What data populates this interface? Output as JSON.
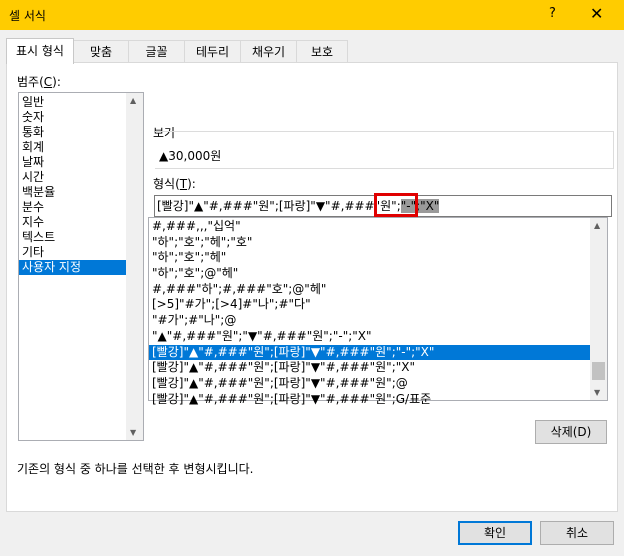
{
  "window": {
    "title": "셀 서식",
    "help_glyph": "?",
    "close_glyph": "✕"
  },
  "tabs": [
    {
      "label": "표시 형식",
      "active": true
    },
    {
      "label": "맞춤"
    },
    {
      "label": "글꼴"
    },
    {
      "label": "테두리"
    },
    {
      "label": "채우기"
    },
    {
      "label": "보호"
    }
  ],
  "category": {
    "label": "범주",
    "mnemonic": "C",
    "items": [
      "일반",
      "숫자",
      "통화",
      "회계",
      "날짜",
      "시간",
      "백분율",
      "분수",
      "지수",
      "텍스트",
      "기타",
      "사용자 지정"
    ],
    "selected_index": 11
  },
  "preview": {
    "label": "보기",
    "value": "▲30,000원"
  },
  "format": {
    "label": "형식",
    "mnemonic": "T",
    "input_prefix": "[빨강]\"▲\"#,###\"원\";[파랑]\"▼\"#,###\"원\";",
    "input_selected": "\"-\";\"X\"",
    "codes": [
      "#,###,,,\"십억\"",
      "\"하\";\"호\";\"헤\";\"호\"",
      "\"하\";\"호\";\"헤\"",
      "\"하\";\"호\";@\"헤\"",
      "#,###\"하\";#,###\"호\";@\"헤\"",
      "[>5]\"#가\";[>4]#\"나\";#\"다\"",
      "\"#가\";#\"나\";@",
      "\"▲\"#,###\"원\";\"▼\"#,###\"원\";\"-\";\"X\"",
      "[빨강]\"▲\"#,###\"원\";[파랑]\"▼\"#,###\"원\";\"-\";\"X\"",
      "[빨강]\"▲\"#,###\"원\";[파랑]\"▼\"#,###\"원\";\"X\"",
      "[빨강]\"▲\"#,###\"원\";[파랑]\"▼\"#,###\"원\";@",
      "[빨강]\"▲\"#,###\"원\";[파랑]\"▼\"#,###\"원\";G/표준"
    ],
    "selected_index": 8
  },
  "buttons": {
    "delete": "삭제(D)",
    "ok": "확인",
    "cancel": "취소"
  },
  "description": "기존의 형식 중 하나를 선택한 후 변형시킵니다.",
  "colors": {
    "title_bar": "#ffcc00",
    "selection": "#0078d7",
    "highlight_box": "#e00000"
  },
  "icons": [
    "scroll-up-arrow-icon",
    "scroll-down-arrow-icon"
  ]
}
